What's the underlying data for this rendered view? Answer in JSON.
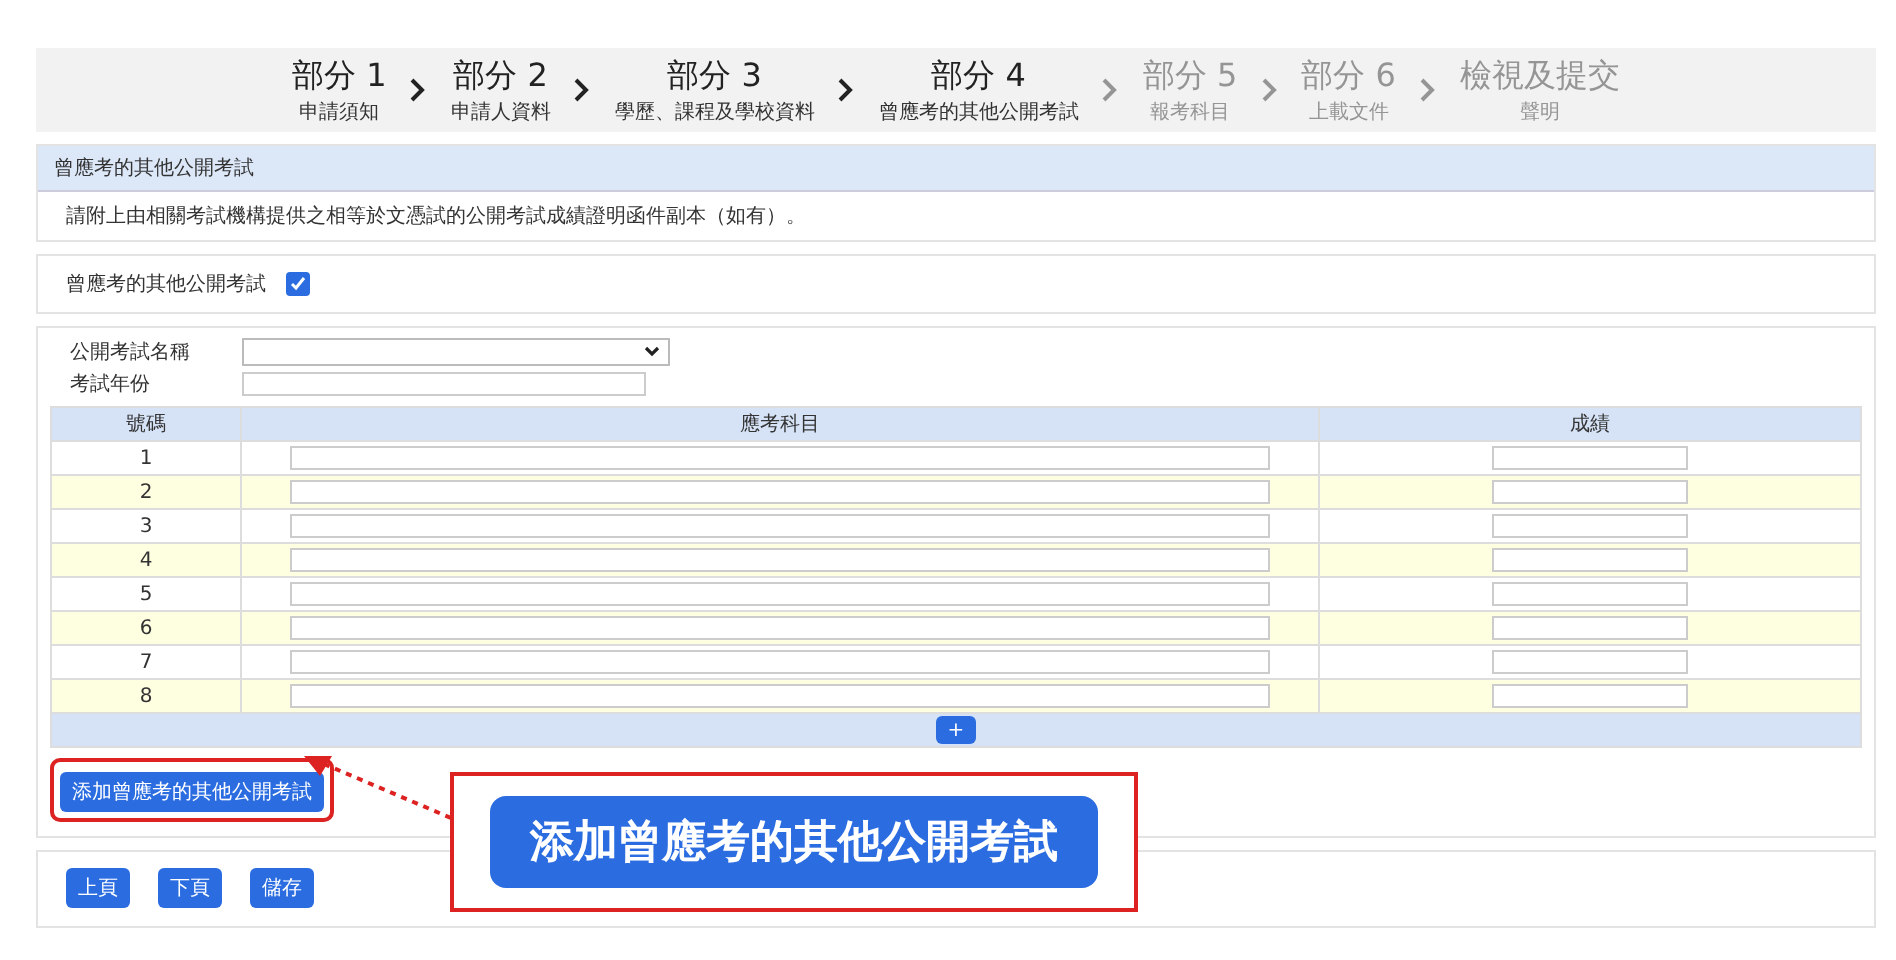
{
  "steps": [
    {
      "title": "部分 1",
      "subtitle": "申請須知",
      "enabled": true
    },
    {
      "title": "部分 2",
      "subtitle": "申請人資料",
      "enabled": true
    },
    {
      "title": "部分 3",
      "subtitle": "學歷、課程及學校資料",
      "enabled": true
    },
    {
      "title": "部分 4",
      "subtitle": "曾應考的其他公開考試",
      "enabled": true
    },
    {
      "title": "部分 5",
      "subtitle": "報考科目",
      "enabled": false
    },
    {
      "title": "部分 6",
      "subtitle": "上載文件",
      "enabled": false
    },
    {
      "title": "檢視及提交",
      "subtitle": "聲明",
      "enabled": false
    }
  ],
  "section_title": "曾應考的其他公開考試",
  "instruction": "請附上由相關考試機構提供之相等於文憑試的公開考試成績證明函件副本（如有）。",
  "checkbox": {
    "label": "曾應考的其他公開考試",
    "checked": true
  },
  "exam_name": {
    "label": "公開考試名稱"
  },
  "exam_year": {
    "label": "考試年份"
  },
  "table": {
    "columns": [
      "號碼",
      "應考科目",
      "成績"
    ],
    "rows": [
      "1",
      "2",
      "3",
      "4",
      "5",
      "6",
      "7",
      "8"
    ],
    "add_row_button": "+"
  },
  "add_exam_button": "添加曾應考的其他公開考試",
  "nav_buttons": [
    "上頁",
    "下頁",
    "儲存"
  ],
  "callout": {
    "text": "添加曾應考的其他公開考試"
  }
}
